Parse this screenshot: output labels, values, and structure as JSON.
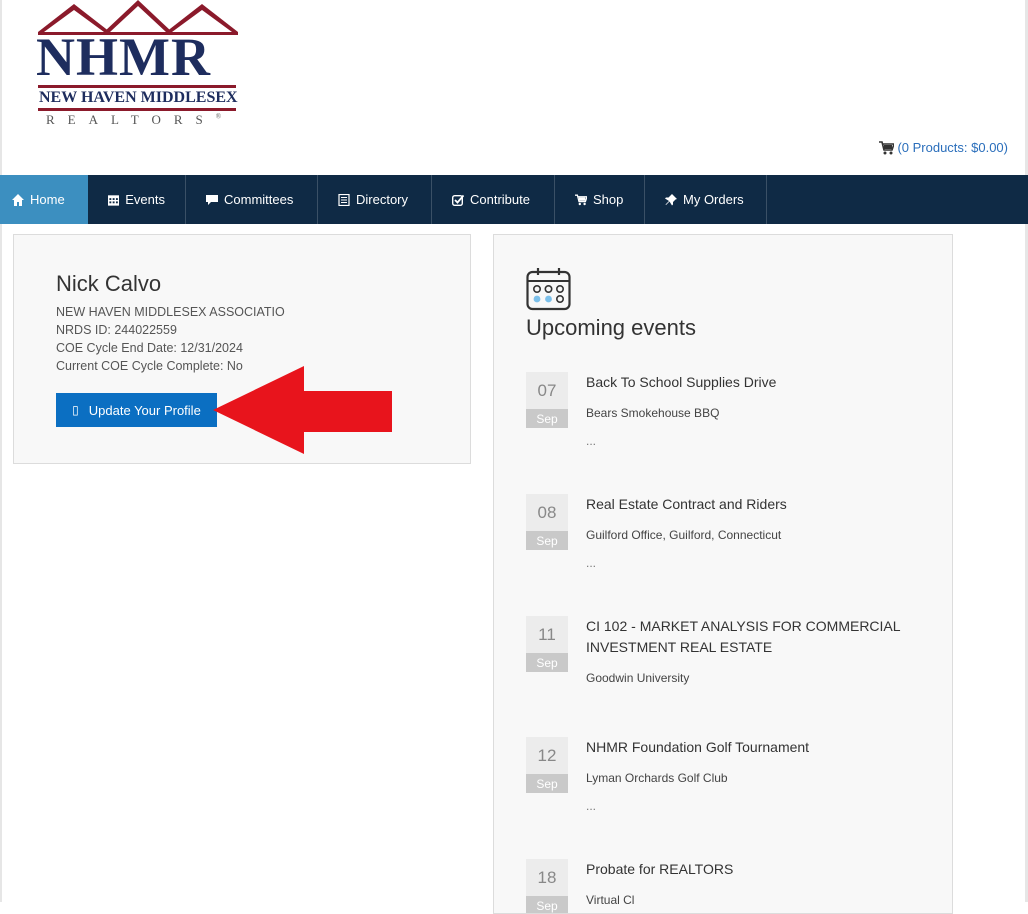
{
  "logo": {
    "main": "NHMR",
    "line2": "NEW HAVEN MIDDLESEX",
    "line3": "REALTORS",
    "mark": "®"
  },
  "cart": {
    "icon": "cart-icon",
    "label": "(0 Products: $0.00)"
  },
  "nav": {
    "items": [
      {
        "label": "Home",
        "icon": "home-icon"
      },
      {
        "label": "Events",
        "icon": "calendar-icon"
      },
      {
        "label": "Committees",
        "icon": "comment-icon"
      },
      {
        "label": "Directory",
        "icon": "list-icon"
      },
      {
        "label": "Contribute",
        "icon": "check-square-icon"
      },
      {
        "label": "Shop",
        "icon": "cart-icon"
      },
      {
        "label": "My Orders",
        "icon": "pin-icon"
      }
    ]
  },
  "profile": {
    "name": "Nick Calvo",
    "association": "NEW HAVEN MIDDLESEX ASSOCIATIO",
    "nrds": "NRDS ID: 244022559",
    "coe_end": "COE Cycle End Date: 12/31/2024",
    "coe_complete": "Current COE Cycle Complete: No",
    "button_icon": "▯",
    "button_label": "Update Your Profile"
  },
  "events": {
    "title": "Upcoming events",
    "items": [
      {
        "day": "07",
        "month": "Sep",
        "title": "Back To School Supplies Drive",
        "location": "Bears Smokehouse BBQ",
        "more": "..."
      },
      {
        "day": "08",
        "month": "Sep",
        "title": "Real Estate Contract and Riders",
        "location": "Guilford Office, Guilford, Connecticut",
        "more": "..."
      },
      {
        "day": "11",
        "month": "Sep",
        "title": "CI 102 - MARKET ANALYSIS FOR COMMERCIAL INVESTMENT REAL ESTATE",
        "location": "Goodwin University",
        "more": ""
      },
      {
        "day": "12",
        "month": "Sep",
        "title": "NHMR Foundation Golf Tournament",
        "location": "Lyman Orchards Golf Club",
        "more": "..."
      },
      {
        "day": "18",
        "month": "Sep",
        "title": "Probate for REALTORS",
        "location": "Virtual Cl",
        "more": ""
      }
    ]
  },
  "colors": {
    "navbar": "#0f2a45",
    "nav_active": "#3c8fc0",
    "button": "#0b6fc2",
    "arrow": "#e8141c",
    "logo_navy": "#1e2d5e",
    "logo_red": "#8b1a2b"
  }
}
